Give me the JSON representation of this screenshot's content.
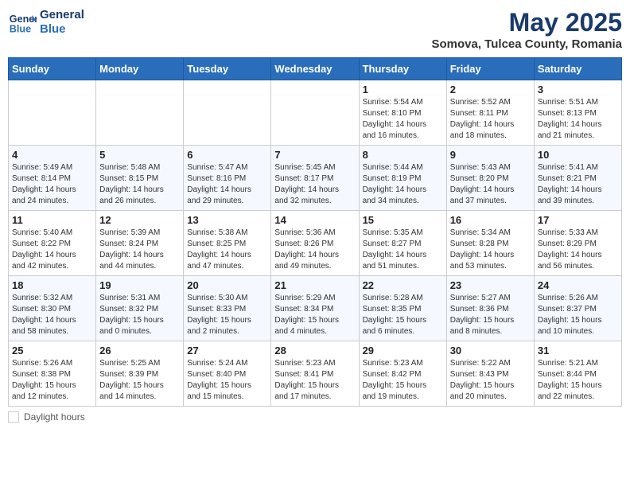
{
  "header": {
    "logo_line1": "General",
    "logo_line2": "Blue",
    "month": "May 2025",
    "location": "Somova, Tulcea County, Romania"
  },
  "weekdays": [
    "Sunday",
    "Monday",
    "Tuesday",
    "Wednesday",
    "Thursday",
    "Friday",
    "Saturday"
  ],
  "weeks": [
    [
      {
        "day": "",
        "info": ""
      },
      {
        "day": "",
        "info": ""
      },
      {
        "day": "",
        "info": ""
      },
      {
        "day": "",
        "info": ""
      },
      {
        "day": "1",
        "info": "Sunrise: 5:54 AM\nSunset: 8:10 PM\nDaylight: 14 hours\nand 16 minutes."
      },
      {
        "day": "2",
        "info": "Sunrise: 5:52 AM\nSunset: 8:11 PM\nDaylight: 14 hours\nand 18 minutes."
      },
      {
        "day": "3",
        "info": "Sunrise: 5:51 AM\nSunset: 8:13 PM\nDaylight: 14 hours\nand 21 minutes."
      }
    ],
    [
      {
        "day": "4",
        "info": "Sunrise: 5:49 AM\nSunset: 8:14 PM\nDaylight: 14 hours\nand 24 minutes."
      },
      {
        "day": "5",
        "info": "Sunrise: 5:48 AM\nSunset: 8:15 PM\nDaylight: 14 hours\nand 26 minutes."
      },
      {
        "day": "6",
        "info": "Sunrise: 5:47 AM\nSunset: 8:16 PM\nDaylight: 14 hours\nand 29 minutes."
      },
      {
        "day": "7",
        "info": "Sunrise: 5:45 AM\nSunset: 8:17 PM\nDaylight: 14 hours\nand 32 minutes."
      },
      {
        "day": "8",
        "info": "Sunrise: 5:44 AM\nSunset: 8:19 PM\nDaylight: 14 hours\nand 34 minutes."
      },
      {
        "day": "9",
        "info": "Sunrise: 5:43 AM\nSunset: 8:20 PM\nDaylight: 14 hours\nand 37 minutes."
      },
      {
        "day": "10",
        "info": "Sunrise: 5:41 AM\nSunset: 8:21 PM\nDaylight: 14 hours\nand 39 minutes."
      }
    ],
    [
      {
        "day": "11",
        "info": "Sunrise: 5:40 AM\nSunset: 8:22 PM\nDaylight: 14 hours\nand 42 minutes."
      },
      {
        "day": "12",
        "info": "Sunrise: 5:39 AM\nSunset: 8:24 PM\nDaylight: 14 hours\nand 44 minutes."
      },
      {
        "day": "13",
        "info": "Sunrise: 5:38 AM\nSunset: 8:25 PM\nDaylight: 14 hours\nand 47 minutes."
      },
      {
        "day": "14",
        "info": "Sunrise: 5:36 AM\nSunset: 8:26 PM\nDaylight: 14 hours\nand 49 minutes."
      },
      {
        "day": "15",
        "info": "Sunrise: 5:35 AM\nSunset: 8:27 PM\nDaylight: 14 hours\nand 51 minutes."
      },
      {
        "day": "16",
        "info": "Sunrise: 5:34 AM\nSunset: 8:28 PM\nDaylight: 14 hours\nand 53 minutes."
      },
      {
        "day": "17",
        "info": "Sunrise: 5:33 AM\nSunset: 8:29 PM\nDaylight: 14 hours\nand 56 minutes."
      }
    ],
    [
      {
        "day": "18",
        "info": "Sunrise: 5:32 AM\nSunset: 8:30 PM\nDaylight: 14 hours\nand 58 minutes."
      },
      {
        "day": "19",
        "info": "Sunrise: 5:31 AM\nSunset: 8:32 PM\nDaylight: 15 hours\nand 0 minutes."
      },
      {
        "day": "20",
        "info": "Sunrise: 5:30 AM\nSunset: 8:33 PM\nDaylight: 15 hours\nand 2 minutes."
      },
      {
        "day": "21",
        "info": "Sunrise: 5:29 AM\nSunset: 8:34 PM\nDaylight: 15 hours\nand 4 minutes."
      },
      {
        "day": "22",
        "info": "Sunrise: 5:28 AM\nSunset: 8:35 PM\nDaylight: 15 hours\nand 6 minutes."
      },
      {
        "day": "23",
        "info": "Sunrise: 5:27 AM\nSunset: 8:36 PM\nDaylight: 15 hours\nand 8 minutes."
      },
      {
        "day": "24",
        "info": "Sunrise: 5:26 AM\nSunset: 8:37 PM\nDaylight: 15 hours\nand 10 minutes."
      }
    ],
    [
      {
        "day": "25",
        "info": "Sunrise: 5:26 AM\nSunset: 8:38 PM\nDaylight: 15 hours\nand 12 minutes."
      },
      {
        "day": "26",
        "info": "Sunrise: 5:25 AM\nSunset: 8:39 PM\nDaylight: 15 hours\nand 14 minutes."
      },
      {
        "day": "27",
        "info": "Sunrise: 5:24 AM\nSunset: 8:40 PM\nDaylight: 15 hours\nand 15 minutes."
      },
      {
        "day": "28",
        "info": "Sunrise: 5:23 AM\nSunset: 8:41 PM\nDaylight: 15 hours\nand 17 minutes."
      },
      {
        "day": "29",
        "info": "Sunrise: 5:23 AM\nSunset: 8:42 PM\nDaylight: 15 hours\nand 19 minutes."
      },
      {
        "day": "30",
        "info": "Sunrise: 5:22 AM\nSunset: 8:43 PM\nDaylight: 15 hours\nand 20 minutes."
      },
      {
        "day": "31",
        "info": "Sunrise: 5:21 AM\nSunset: 8:44 PM\nDaylight: 15 hours\nand 22 minutes."
      }
    ]
  ],
  "footer": {
    "legend_label": "Daylight hours"
  }
}
